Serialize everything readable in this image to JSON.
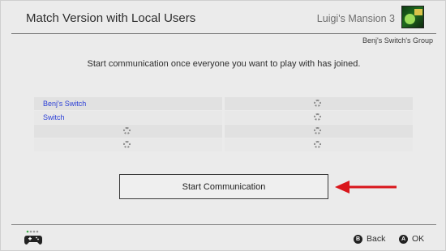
{
  "header": {
    "title": "Match Version with Local Users",
    "game_title": "Luigi's Mansion 3",
    "game_icon": "luigis-mansion-3-icon",
    "group_label": "Benj's Switch's Group"
  },
  "instruction": "Start communication once everyone you want to play with has joined.",
  "players": {
    "rows": [
      {
        "left": "Benj's Switch",
        "right": ""
      },
      {
        "left": "Switch",
        "right": ""
      },
      {
        "left": "",
        "right": ""
      },
      {
        "left": "",
        "right": ""
      }
    ]
  },
  "start_button": {
    "label": "Start Communication"
  },
  "annotation": {
    "icon": "red-arrow-icon",
    "color": "#d9161b"
  },
  "footer": {
    "controller_icon": "controller-icon",
    "back": {
      "key": "B",
      "label": "Back"
    },
    "ok": {
      "key": "A",
      "label": "OK"
    }
  },
  "colors": {
    "player_name": "#2b3fd6",
    "background": "#ebebeb"
  }
}
